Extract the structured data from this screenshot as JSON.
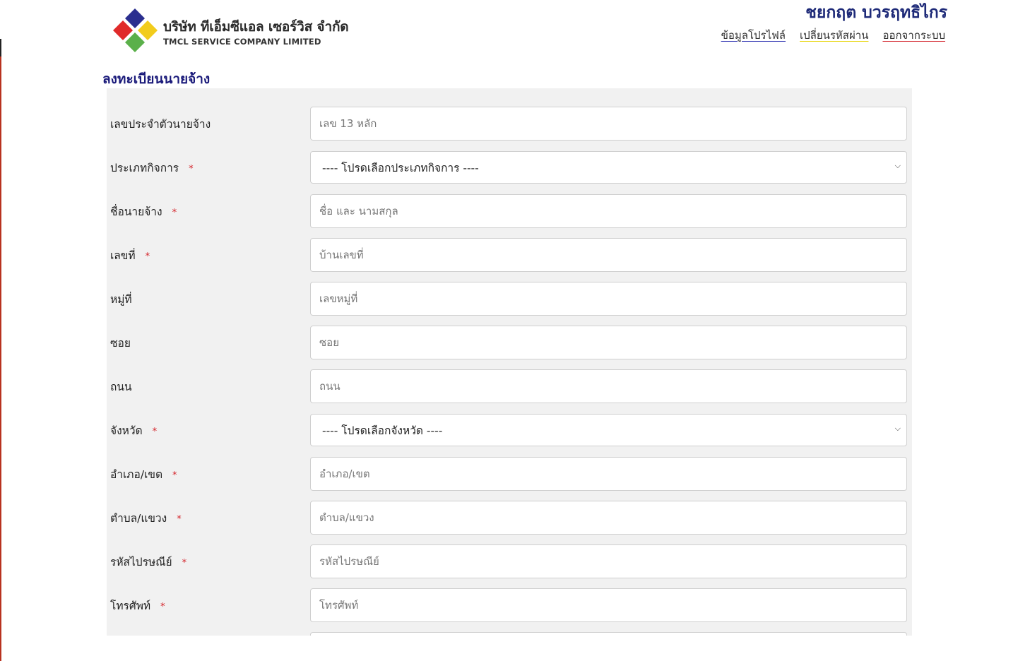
{
  "brand": {
    "name_th": "บริษัท ทีเอ็มซีแอล เซอร์วิส จำกัด",
    "name_en": "TMCL SERVICE COMPANY LIMITED",
    "colors": {
      "blue": "#2b2f8f",
      "red": "#e02a2a",
      "yellow": "#f2cc1c",
      "green": "#5bb04a"
    }
  },
  "header": {
    "user_name": "ชยกฤต บวรฤทธิไกร",
    "nav": [
      {
        "label": "ข้อมูลโปรไฟล์"
      },
      {
        "label": "เปลี่ยนรหัสผ่าน"
      },
      {
        "label": "ออกจากระบบ"
      }
    ]
  },
  "page": {
    "title": "ลงทะเบียนนายจ้าง"
  },
  "form": {
    "fields": [
      {
        "label": "เลขประจำตัวนายจ้าง",
        "required": false,
        "type": "text",
        "placeholder": "เลข 13 หลัก"
      },
      {
        "label": "ประเภทกิจการ",
        "required": true,
        "type": "select",
        "selected": "---- โปรดเลือกประเภทกิจการ ----"
      },
      {
        "label": "ชื่อนายจ้าง",
        "required": true,
        "type": "text",
        "placeholder": "ชื่อ และ นามสกุล"
      },
      {
        "label": "เลขที่",
        "required": true,
        "type": "text",
        "placeholder": "บ้านเลขที่"
      },
      {
        "label": "หมู่ที่",
        "required": false,
        "type": "text",
        "placeholder": "เลขหมู่ที่"
      },
      {
        "label": "ซอย",
        "required": false,
        "type": "text",
        "placeholder": "ซอย"
      },
      {
        "label": "ถนน",
        "required": false,
        "type": "text",
        "placeholder": "ถนน"
      },
      {
        "label": "จังหวัด",
        "required": true,
        "type": "select",
        "selected": "---- โปรดเลือกจังหวัด ----"
      },
      {
        "label": "อำเภอ/เขต",
        "required": true,
        "type": "text",
        "placeholder": "อำเภอ/เขต"
      },
      {
        "label": "ตำบล/แขวง",
        "required": true,
        "type": "text",
        "placeholder": "ตำบล/แขวง"
      },
      {
        "label": "รหัสไปรษณีย์",
        "required": true,
        "type": "text",
        "placeholder": "รหัสไปรษณีย์"
      },
      {
        "label": "โทรศัพท์",
        "required": true,
        "type": "text",
        "placeholder": "โทรศัพท์"
      }
    ],
    "required_mark": "*"
  }
}
